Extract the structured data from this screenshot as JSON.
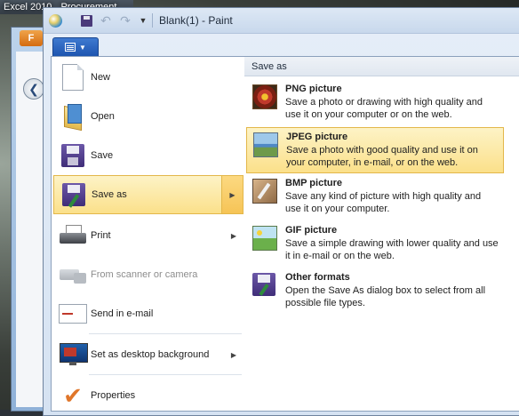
{
  "background": {
    "excel_title": "Excel 2010",
    "excel_title_extra": "Procurement",
    "behind_tab": "F"
  },
  "window": {
    "title": "Blank(1) - Paint"
  },
  "menu": {
    "items": [
      {
        "label": "New"
      },
      {
        "label": "Open"
      },
      {
        "label": "Save"
      },
      {
        "label": "Save as"
      },
      {
        "label": "Print"
      },
      {
        "label": "From scanner or camera"
      },
      {
        "label": "Send in e-mail"
      },
      {
        "label": "Set as desktop background"
      },
      {
        "label": "Properties"
      }
    ]
  },
  "save_as": {
    "header": "Save as",
    "formats": [
      {
        "title": "PNG picture",
        "desc": "Save a photo or drawing with high quality and use it on your computer or on the web."
      },
      {
        "title": "JPEG picture",
        "desc": "Save a photo with good quality and use it on your computer, in e-mail, or on the web."
      },
      {
        "title": "BMP picture",
        "desc": "Save any kind of picture with high quality and use it on your computer."
      },
      {
        "title": "GIF picture",
        "desc": "Save a simple drawing with lower quality and use it in e-mail or on the web."
      },
      {
        "title": "Other formats",
        "desc": "Open the Save As dialog box to select from all possible file types."
      }
    ]
  },
  "colors": {
    "highlight": "#fbe08a",
    "menu_button": "#1e55b0"
  }
}
